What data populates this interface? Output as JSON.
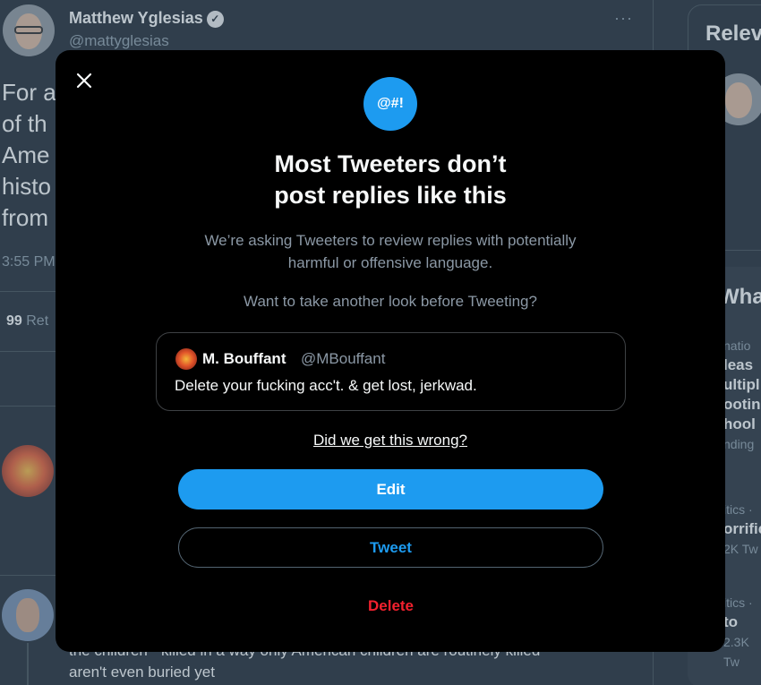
{
  "background": {
    "tweet": {
      "author_name": "Matthew Yglesias",
      "author_handle": "@mattyglesias",
      "more": "···",
      "text_lines": [
        "For a",
        "of th",
        "Ame",
        "histo",
        "from"
      ],
      "time": "3:55 PM",
      "retweet_count": "99",
      "retweet_label": "Ret"
    },
    "reply": {
      "text_line1": "the children - killed in a way only American children are routinely killed",
      "text_line2": "aren't even buried yet"
    },
    "sidebar": {
      "relevant_title": "Relev",
      "whats_title": "What",
      "trends": [
        {
          "meta": "natio",
          "topic_lines": [
            "leas",
            "ultipl",
            "ootin",
            "hool"
          ],
          "count": "nding"
        },
        {
          "meta": "itics ·",
          "topic_lines": [
            "orrific"
          ],
          "count": "2K Tw"
        },
        {
          "meta": "itics ·",
          "topic_lines": [
            "to"
          ],
          "count": "2.3K Tw"
        }
      ]
    }
  },
  "modal": {
    "close_icon": "close-icon",
    "badge_text": "@#!",
    "headline_line1": "Most Tweeters don’t",
    "headline_line2": "post replies like this",
    "subtext_line1": "We’re asking Tweeters to review replies with potentially",
    "subtext_line2": "harmful or offensive language.",
    "question": "Want to take another look before Tweeting?",
    "preview": {
      "name": "M. Bouffant",
      "handle": "@MBouffant",
      "text": "Delete your fucking acc't. & get lost, jerkwad."
    },
    "wrong_link": "Did we get this wrong?",
    "edit_label": "Edit",
    "tweet_label": "Tweet",
    "delete_label": "Delete"
  },
  "colors": {
    "accent": "#1d9bf0",
    "danger": "#f4212e",
    "modal_bg": "#000000",
    "page_bg": "#15202b"
  }
}
